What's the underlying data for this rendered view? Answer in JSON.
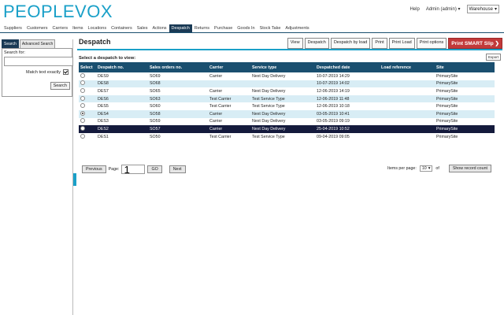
{
  "app": {
    "logo": "PEOPLEVOX",
    "help": "Help",
    "user": "Admin (admin)",
    "warehouse": "Warehouse"
  },
  "nav": [
    {
      "label": "Suppliers"
    },
    {
      "label": "Customers"
    },
    {
      "label": "Carriers"
    },
    {
      "label": "Items"
    },
    {
      "label": "Locations"
    },
    {
      "label": "Containers"
    },
    {
      "label": "Sales"
    },
    {
      "label": "Actions"
    },
    {
      "label": "Despatch",
      "active": true
    },
    {
      "label": "Returns"
    },
    {
      "label": "Purchase"
    },
    {
      "label": "Goods In"
    },
    {
      "label": "Stock Take"
    },
    {
      "label": "Adjustments"
    }
  ],
  "sidebar": {
    "tab_search": "Search",
    "tab_advanced": "Advanced Search",
    "search_label": "Search for:",
    "search_value": "",
    "match_label": "Match text exactly",
    "match_checked": true,
    "search_button": "Search"
  },
  "main": {
    "title": "Despatch",
    "buttons": {
      "view": "View",
      "despatch": "Despatch",
      "despatch_by_load": "Despatch by load",
      "print": "Print",
      "print_load": "Print Load",
      "print_options": "Print options",
      "print_smart_slip": "Print SMART Slip"
    },
    "export": "Export",
    "select_title": "Select a despatch to view:"
  },
  "table": {
    "headers": [
      "Select",
      "Despatch no.",
      "Sales orders no.",
      "Carrier",
      "Service type",
      "Despatched date",
      "Load reference",
      "Site"
    ],
    "rows": [
      {
        "despatch": "DES9",
        "order": "SO69",
        "carrier": "Carrier",
        "service": "Next Day Delivery",
        "date": "10-07-2019 14:29",
        "load": "",
        "site": "PrimarySite"
      },
      {
        "despatch": "DES8",
        "order": "SO68",
        "carrier": "",
        "service": "",
        "date": "10-07-2019 14:02",
        "load": "",
        "site": "PrimarySite"
      },
      {
        "despatch": "DES7",
        "order": "SO65",
        "carrier": "Carrier",
        "service": "Next Day Delivery",
        "date": "12-06-2019 14:19",
        "load": "",
        "site": "PrimarySite"
      },
      {
        "despatch": "DES6",
        "order": "SO63",
        "carrier": "Test Carrier",
        "service": "Test Service Type",
        "date": "12-06-2019 11:48",
        "load": "",
        "site": "PrimarySite"
      },
      {
        "despatch": "DES5",
        "order": "SO60",
        "carrier": "Test Carrier",
        "service": "Test Service Type",
        "date": "12-06-2019 10:18",
        "load": "",
        "site": "PrimarySite"
      },
      {
        "despatch": "DES4",
        "order": "SO58",
        "carrier": "Carrier",
        "service": "Next Day Delivery",
        "date": "03-05-2019 10:41",
        "load": "",
        "site": "PrimarySite"
      },
      {
        "despatch": "DES3",
        "order": "SO59",
        "carrier": "Carrier",
        "service": "Next Day Delivery",
        "date": "03-05-2019 09:19",
        "load": "",
        "site": "PrimarySite"
      },
      {
        "despatch": "DES2",
        "order": "SO57",
        "carrier": "Carrier",
        "service": "Next Day Delivery",
        "date": "25-04-2019 10:52",
        "load": "",
        "site": "PrimarySite"
      },
      {
        "despatch": "DES1",
        "order": "SO50",
        "carrier": "Test Carrier",
        "service": "Test Service Type",
        "date": "09-04-2019 09:05",
        "load": "",
        "site": "PrimarySite"
      }
    ]
  },
  "pager": {
    "previous": "Previous",
    "page_label": "Page:",
    "page_value": "1",
    "go": "GO",
    "next": "Next",
    "items_per_page_label": "Items per page:",
    "items_per_page": "10",
    "of_label": "of",
    "show_record_count": "Show record count"
  },
  "colors": {
    "brand": "#1aa0c8",
    "header": "#1a4f6f",
    "selected_row": "#141a3c",
    "alt_row": "#d8edf5",
    "smart_slip": "#c23a3a"
  }
}
